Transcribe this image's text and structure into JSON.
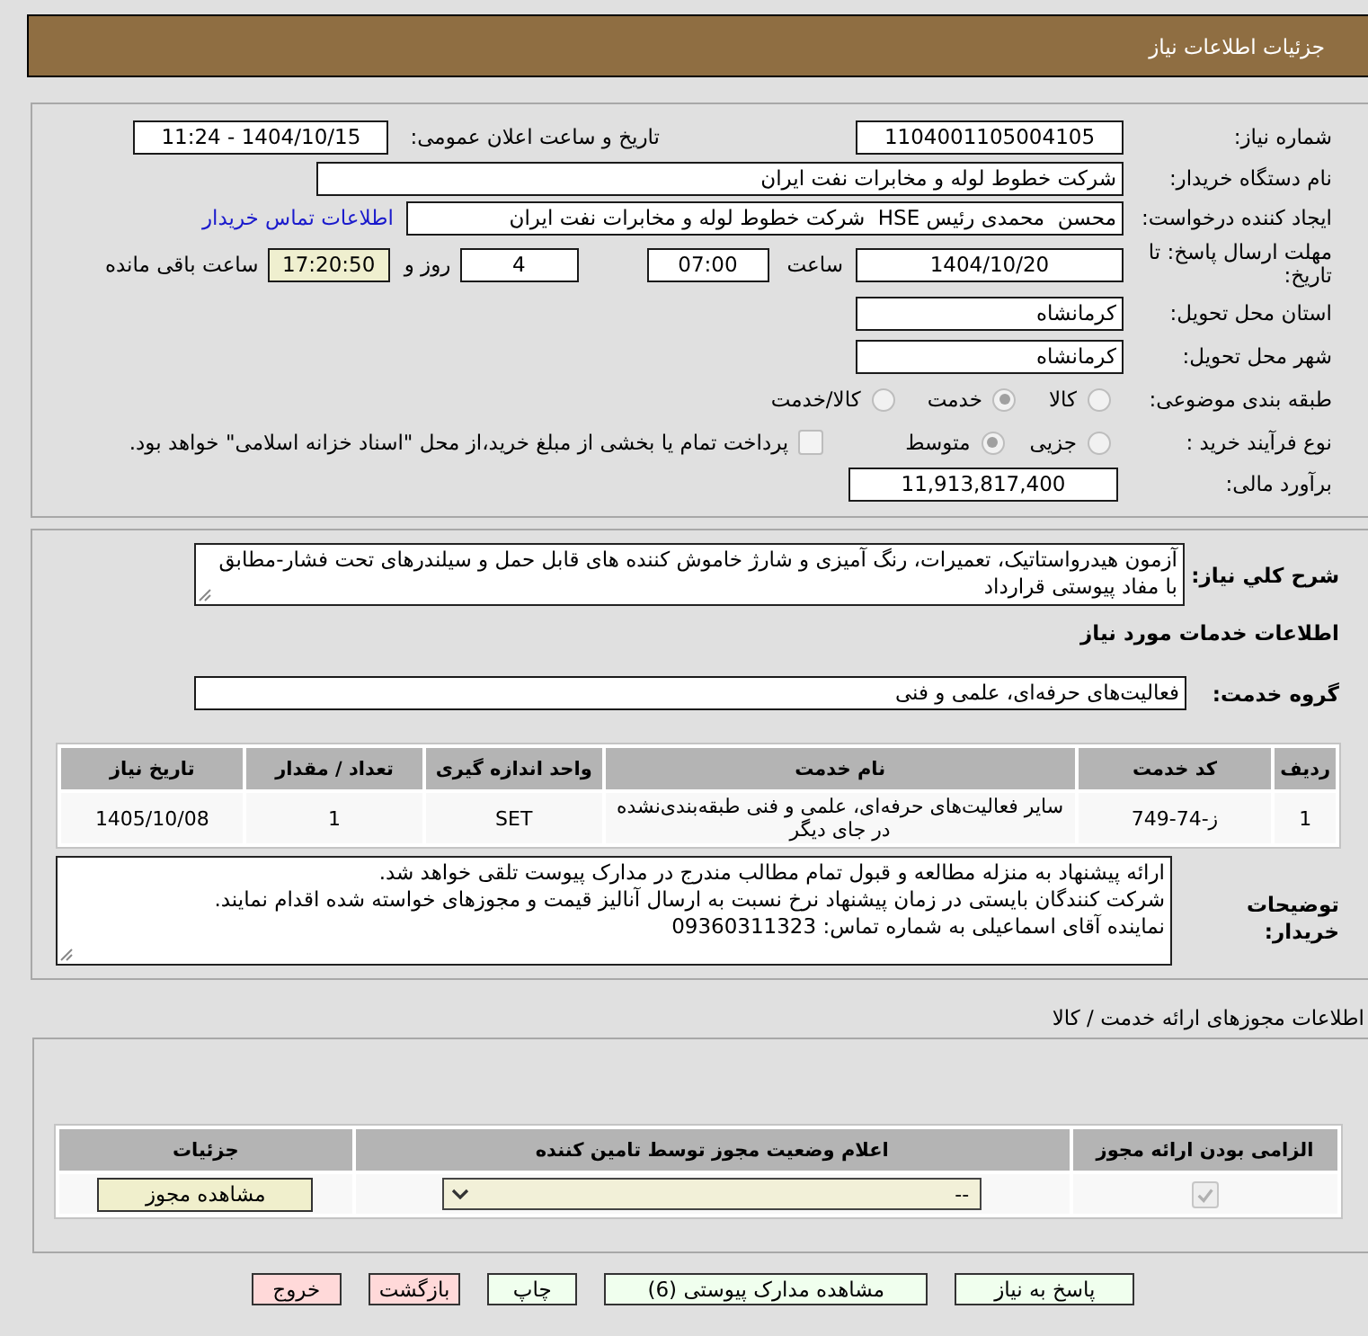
{
  "header": {
    "title": "جزئیات اطلاعات نیاز"
  },
  "need_number": {
    "label": "شماره نیاز:",
    "value": "1104001105004105"
  },
  "announce": {
    "label": "تاریخ و ساعت اعلان عمومی:",
    "value": "1404/10/15 - 11:24"
  },
  "buyer_org": {
    "label": "نام دستگاه خریدار:",
    "value": "شرکت خطوط لوله و مخابرات نفت ایران"
  },
  "requester": {
    "label": "ایجاد کننده درخواست:",
    "value": "محسن  محمدی رئیس HSE  شرکت خطوط لوله و مخابرات نفت ایران",
    "contact_link": "اطلاعات تماس خریدار"
  },
  "deadline": {
    "label": "مهلت ارسال پاسخ: تا تاریخ:",
    "date": "1404/10/20",
    "time_label": "ساعت",
    "time": "07:00",
    "days": "4",
    "days_label": "روز و",
    "remaining": "17:20:50",
    "remaining_label": "ساعت باقی مانده"
  },
  "province": {
    "label": "استان محل تحویل:",
    "value": "کرمانشاه"
  },
  "city": {
    "label": "شهر محل تحویل:",
    "value": "کرمانشاه"
  },
  "category": {
    "label": "طبقه بندی موضوعی:",
    "options": [
      {
        "label": "کالا",
        "selected": false
      },
      {
        "label": "خدمت",
        "selected": true
      },
      {
        "label": "کالا/خدمت",
        "selected": false
      }
    ]
  },
  "purchase_type": {
    "label": "نوع فرآیند خرید :",
    "options": [
      {
        "label": "جزیی",
        "selected": false
      },
      {
        "label": "متوسط",
        "selected": true
      }
    ],
    "treasury": {
      "checked": false,
      "label": "پرداخت تمام یا بخشی از مبلغ خرید،از محل \"اسناد خزانه اسلامی\" خواهد بود."
    }
  },
  "budget": {
    "label": "برآورد مالی:",
    "value": "11,913,817,400"
  },
  "summary": {
    "label": "شرح کلي نیاز:",
    "value": "آزمون هیدرواستاتیک، تعمیرات، رنگ آمیزی و شارژ خاموش کننده های قابل حمل و سیلندرهای تحت فشار-مطابق با مفاد پیوستی قرارداد"
  },
  "services": {
    "title": "اطلاعات خدمات مورد نیاز",
    "group_label": "گروه خدمت:",
    "group_value": "فعالیت‌های حرفه‌ای، علمی و فنی",
    "columns": [
      "ردیف",
      "کد خدمت",
      "نام خدمت",
      "واحد اندازه گیری",
      "تعداد / مقدار",
      "تاریخ نیاز"
    ],
    "rows": [
      [
        "1",
        "ز-74-749",
        "سایر فعالیت‌های حرفه‌ای، علمی و فنی طبقه‌بندی‌نشده در جای دیگر",
        "SET",
        "1",
        "1405/10/08"
      ]
    ]
  },
  "buyer_notes": {
    "label": "توضیحات خریدار:",
    "value": "ارائه پیشنهاد به منزله مطالعه و قبول تمام مطالب مندرج در مدارک پیوست تلقی خواهد شد.\nشرکت کنندگان بایستی در زمان پیشنهاد نرخ نسبت به ارسال آنالیز قیمت و مجوزهای خواسته شده اقدام نمایند.\nنماینده آقای اسماعیلی به شماره تماس: 09360311323"
  },
  "licenses": {
    "title": "اطلاعات مجوزهای ارائه خدمت / کالا",
    "columns": [
      "الزامی بودن ارائه مجوز",
      "اعلام وضعیت مجوز توسط تامین کننده",
      "جزئیات"
    ],
    "rows": [
      {
        "required": true,
        "status": "--",
        "details_button": "مشاهده مجوز"
      }
    ]
  },
  "actions": [
    {
      "label": "پاسخ به نیاز",
      "kind": "primary"
    },
    {
      "label": "مشاهده مدارک پیوستی (6)",
      "kind": "primary"
    },
    {
      "label": "چاپ",
      "kind": "primary"
    },
    {
      "label": "بازگشت",
      "kind": "danger"
    },
    {
      "label": "خروج",
      "kind": "danger"
    }
  ]
}
